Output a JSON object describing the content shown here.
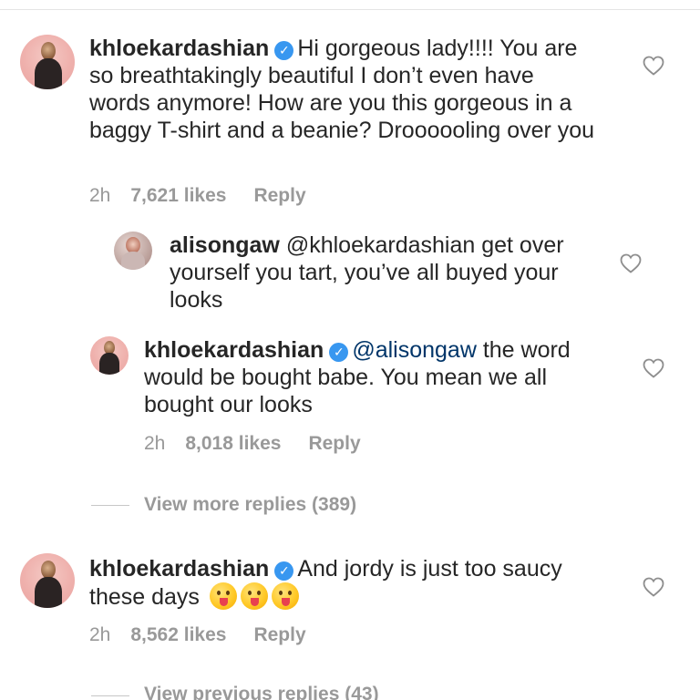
{
  "comments": [
    {
      "username": "khloekardashian",
      "verified": true,
      "text": "Hi gorgeous lady!!!! You are so breathtakingly beautiful I don’t even have words anymore! How are you this gorgeous in a baggy T-shirt and a beanie? Droooooling over you",
      "time": "2h",
      "likes": "7,621 likes",
      "reply": "Reply",
      "replies": [
        {
          "username": "alisongaw",
          "verified": false,
          "mention": "@khloekardashian",
          "text": "get over yourself you tart, you’ve all buyed your looks"
        },
        {
          "username": "khloekardashian",
          "verified": true,
          "mention": "@alisongaw",
          "text": "the word would be bought babe. You mean we all bought our looks",
          "time": "2h",
          "likes": "8,018 likes",
          "reply": "Reply"
        }
      ],
      "view_more": "View more replies (389)"
    },
    {
      "username": "khloekardashian",
      "verified": true,
      "text": "And jordy is just too saucy these days",
      "emoji": [
        "face-with-tongue",
        "face-with-tongue",
        "face-with-tongue"
      ],
      "time": "2h",
      "likes": "8,562 likes",
      "reply": "Reply",
      "view_previous": "View previous replies (43)"
    }
  ],
  "icons": {
    "verified": "verified-badge-icon",
    "like": "heart-outline-icon"
  },
  "colors": {
    "verified": "#3897f0",
    "mention": "#003569",
    "meta": "#999999",
    "text": "#262626"
  }
}
